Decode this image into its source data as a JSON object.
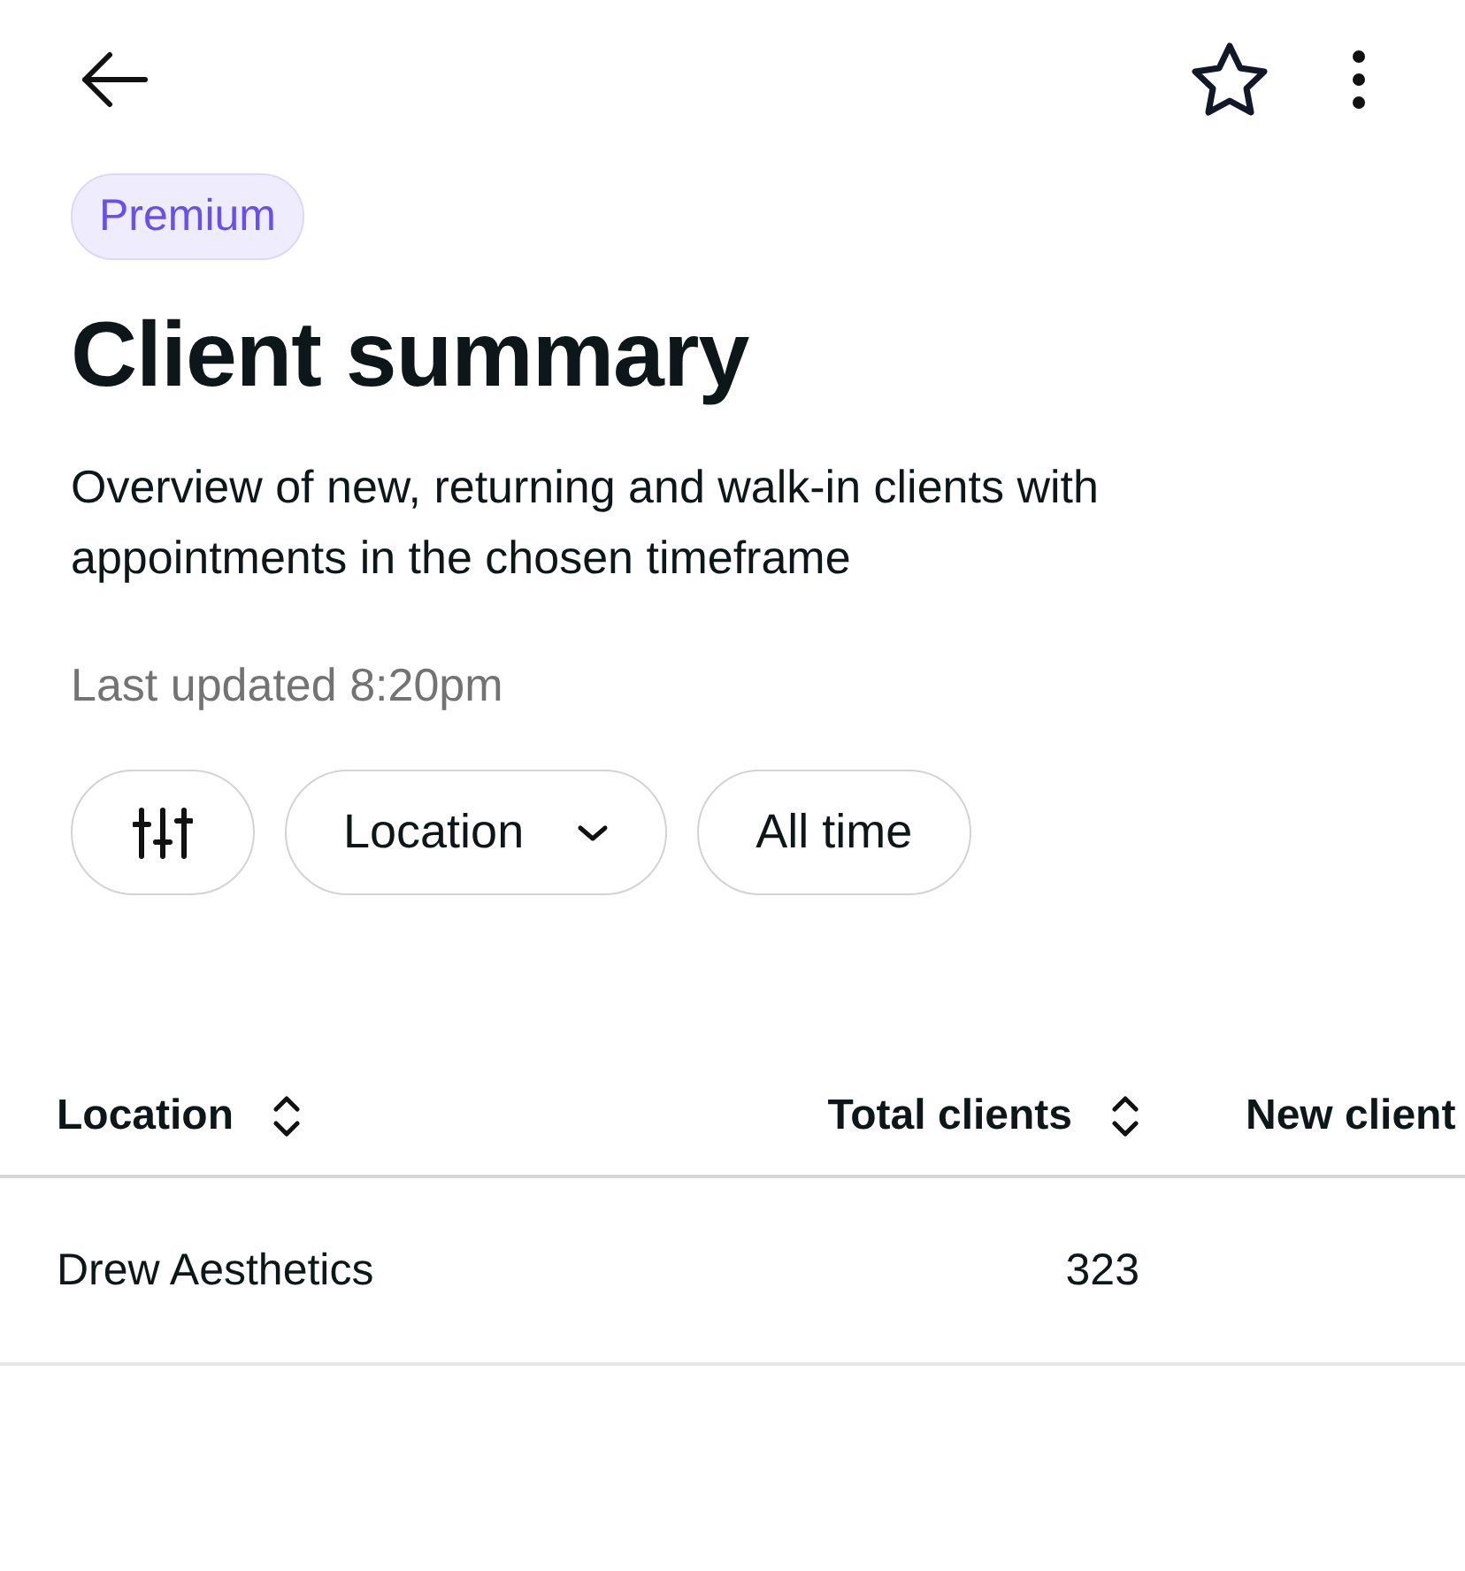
{
  "badge": "Premium",
  "title": "Client summary",
  "description": "Overview of new, returning and walk-in clients with appointments in the chosen timeframe",
  "last_updated": "Last updated 8:20pm",
  "filters": [
    {
      "kind": "icon"
    },
    {
      "kind": "dropdown",
      "label": "Location"
    },
    {
      "kind": "plain",
      "label": "All time"
    }
  ],
  "table": {
    "columns": [
      {
        "label": "Location",
        "sortable": true
      },
      {
        "label": "Total clients",
        "sortable": true
      },
      {
        "label": "New client",
        "sortable": false
      }
    ],
    "rows": [
      [
        "Drew Aesthetics",
        "323"
      ]
    ]
  }
}
